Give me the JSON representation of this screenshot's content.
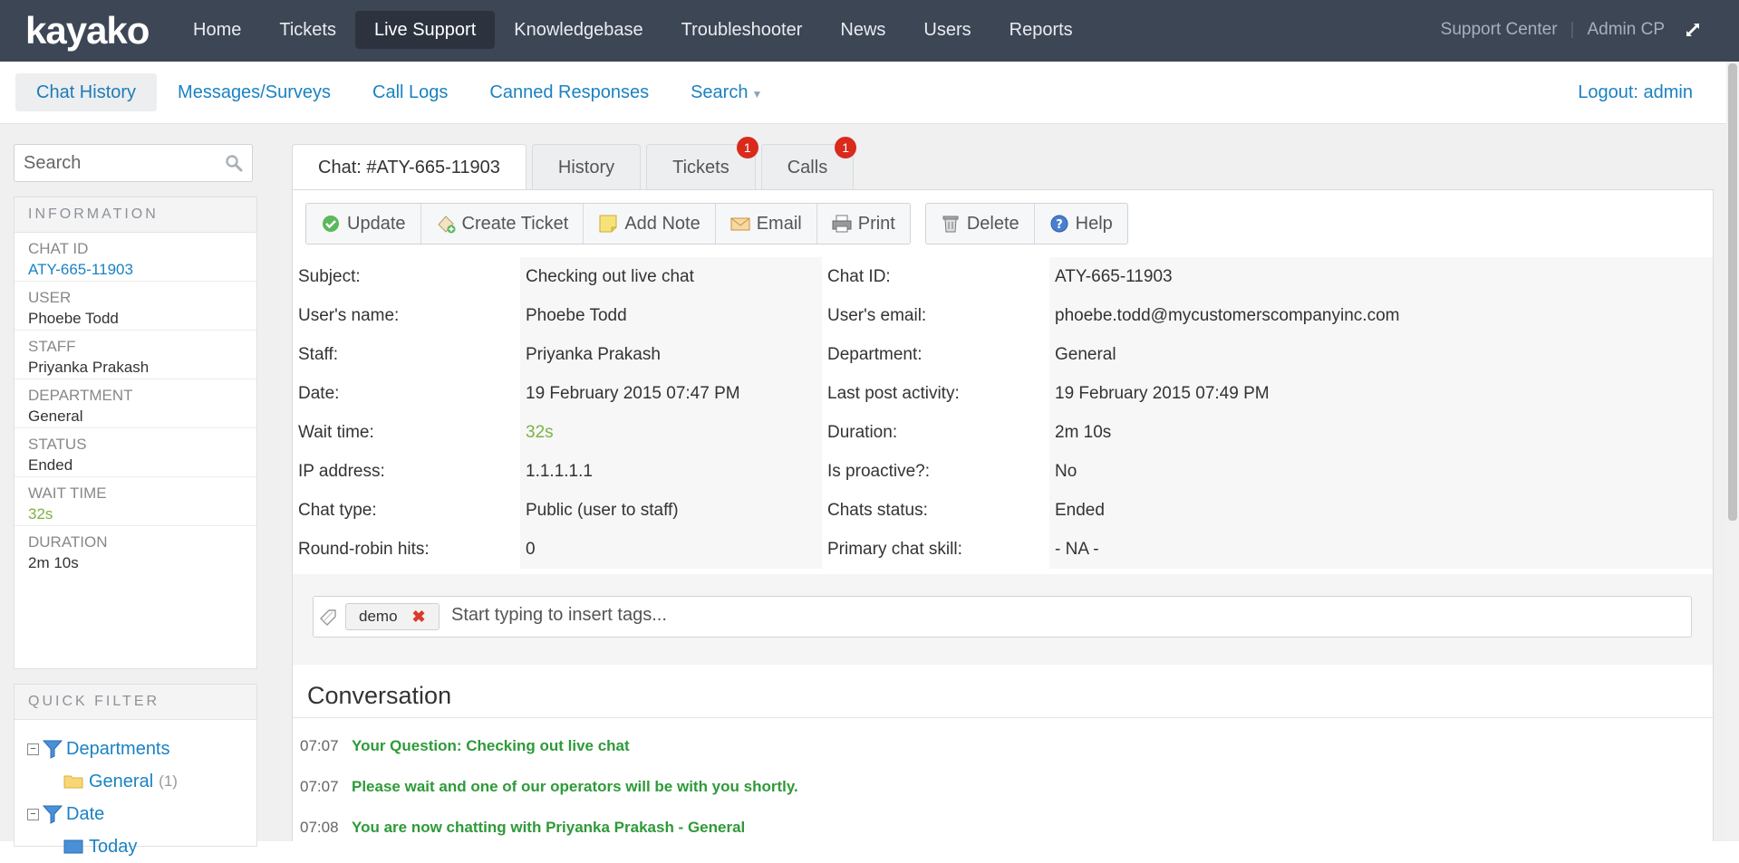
{
  "brand": "kayako",
  "topnav": [
    "Home",
    "Tickets",
    "Live Support",
    "Knowledgebase",
    "Troubleshooter",
    "News",
    "Users",
    "Reports"
  ],
  "topright": {
    "support_center": "Support Center",
    "separator": "|",
    "admin_cp": "Admin CP"
  },
  "subnav": {
    "items": [
      "Chat History",
      "Messages/Surveys",
      "Call Logs",
      "Canned Responses",
      "Search"
    ],
    "logout": "Logout: admin"
  },
  "sidebar": {
    "search_placeholder": "Search",
    "info_title": "INFORMATION",
    "info": [
      {
        "label": "CHAT ID",
        "value": "ATY-665-11903"
      },
      {
        "label": "USER",
        "value": "Phoebe Todd"
      },
      {
        "label": "STAFF",
        "value": "Priyanka Prakash"
      },
      {
        "label": "DEPARTMENT",
        "value": "General"
      },
      {
        "label": "STATUS",
        "value": "Ended"
      },
      {
        "label": "WAIT TIME",
        "value": "32s"
      },
      {
        "label": "DURATION",
        "value": "2m 10s"
      }
    ],
    "quick_filter_title": "QUICK FILTER",
    "tree": {
      "departments": "Departments",
      "general": "General",
      "general_count": "(1)",
      "date": "Date",
      "today": "Today"
    }
  },
  "tabs": [
    {
      "label": "Chat: #ATY-665-11903"
    },
    {
      "label": "History"
    },
    {
      "label": "Tickets",
      "badge": "1"
    },
    {
      "label": "Calls",
      "badge": "1"
    }
  ],
  "toolbar": {
    "update": "Update",
    "create_ticket": "Create Ticket",
    "add_note": "Add Note",
    "email": "Email",
    "print": "Print",
    "delete": "Delete",
    "help": "Help"
  },
  "details": [
    [
      "Subject:",
      "Checking out live chat",
      "Chat ID:",
      "ATY-665-11903"
    ],
    [
      "User's name:",
      "Phoebe Todd",
      "User's email:",
      "phoebe.todd@mycustomerscompanyinc.com"
    ],
    [
      "Staff:",
      "Priyanka Prakash",
      "Department:",
      "General"
    ],
    [
      "Date:",
      "19 February 2015 07:47 PM",
      "Last post activity:",
      "19 February 2015 07:49 PM"
    ],
    [
      "Wait time:",
      "32s",
      "Duration:",
      "2m 10s"
    ],
    [
      "IP address:",
      "1.1.1.1.1",
      "Is proactive?:",
      "No"
    ],
    [
      "Chat type:",
      "Public (user to staff)",
      "Chats status:",
      "Ended"
    ],
    [
      "Round-robin hits:",
      "0",
      "Primary chat skill:",
      "- NA -"
    ]
  ],
  "tags": {
    "chip": "demo",
    "remove": "✖",
    "placeholder": "Start typing to insert tags..."
  },
  "conversation": {
    "title": "Conversation",
    "messages": [
      {
        "time": "07:07",
        "text": "Your Question: Checking out live chat"
      },
      {
        "time": "07:07",
        "text": "Please wait and one of our operators will be with you shortly."
      },
      {
        "time": "07:08",
        "text": "You are now chatting with Priyanka Prakash - General"
      }
    ]
  },
  "colors": {
    "topbar": "#3d4655",
    "link": "#1a82c3",
    "green": "#7cb342",
    "message_green": "#2e9a39",
    "badge": "#d92a1c"
  }
}
